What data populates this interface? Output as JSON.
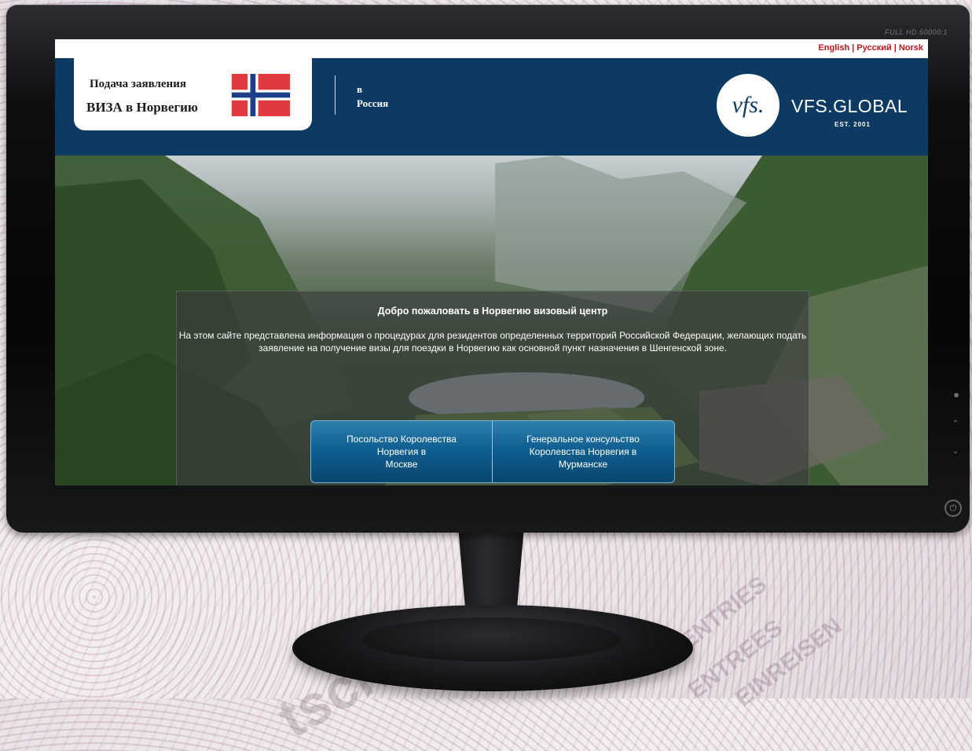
{
  "background": {
    "stamps": [
      "OF ENTRIES",
      "ENTREES",
      "EINREISEN",
      "tsch"
    ]
  },
  "monitor": {
    "bezel_label": "FULL HD 50000:1"
  },
  "languages": [
    "English",
    "Русский",
    "Norsk"
  ],
  "header": {
    "title_line1": "Подача заявления",
    "title_line2": "ВИЗА в Норвегию",
    "country_prefix": "в",
    "country_name": "Россия",
    "logo_mark": "vfs.",
    "logo_word": "VFS.GLOBAL",
    "logo_est": "EST. 2001",
    "colors": {
      "header_bg": "#0d3a63",
      "lang_link": "#c0161d",
      "flag_red": "#e03a3e",
      "flag_blue": "#1d3f87"
    }
  },
  "welcome": {
    "title": "Добро пожаловать в Норвегию визовый центр",
    "body": "На этом сайте представлена информация о процедурах для резидентов определенных территорий Российской Федерации, желающих подать заявление на получение визы для поездки в Норвегию как основной пункт назначения в Шенгенской зоне."
  },
  "missions": [
    {
      "line1": "Посольство Королевства",
      "line2": "Норвегия в",
      "line3": "Москве"
    },
    {
      "line1": "Генеральное консульство",
      "line2": "Королевства Норвегия в",
      "line3": "Мурманске"
    }
  ]
}
